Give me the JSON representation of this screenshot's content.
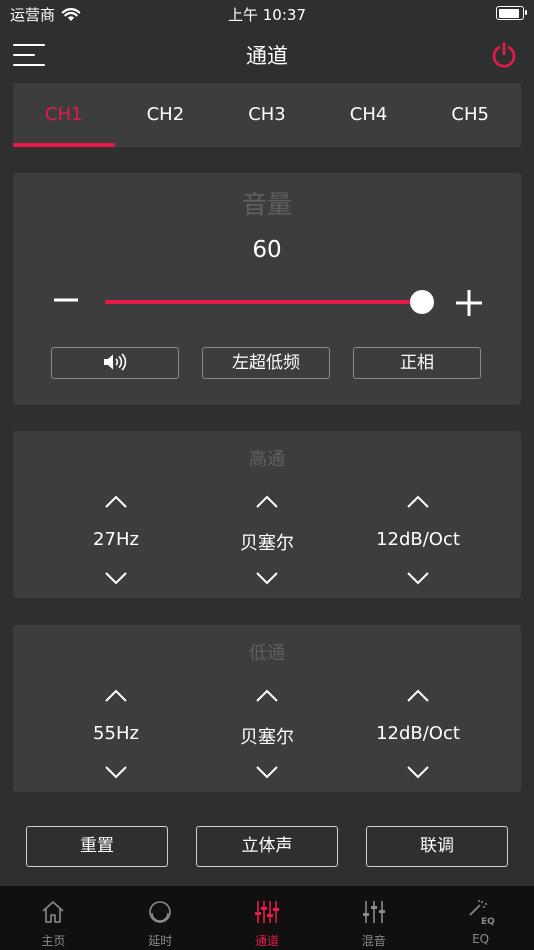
{
  "status": {
    "carrier": "运营商",
    "time": "上午 10:37",
    "battery_level": 0.9
  },
  "nav": {
    "title": "通道"
  },
  "tabs": [
    "CH1",
    "CH2",
    "CH3",
    "CH4",
    "CH5"
  ],
  "active_tab": 0,
  "volume": {
    "title": "音量",
    "value": "60",
    "level": 0.965,
    "buttons": {
      "channel": "左超低频",
      "phase": "正相"
    }
  },
  "high_pass": {
    "title": "高通",
    "freq": "27Hz",
    "type": "贝塞尔",
    "slope": "12dB/Oct"
  },
  "low_pass": {
    "title": "低通",
    "freq": "55Hz",
    "type": "贝塞尔",
    "slope": "12dB/Oct"
  },
  "actions": {
    "reset": "重置",
    "stereo": "立体声",
    "link": "联调"
  },
  "tabbar": {
    "items": [
      "主页",
      "延时",
      "通道",
      "混音",
      "EQ"
    ],
    "active": 2
  },
  "colors": {
    "accent": "#e6194b",
    "background": "#2f2f2f",
    "panel": "#3d3d3d"
  }
}
